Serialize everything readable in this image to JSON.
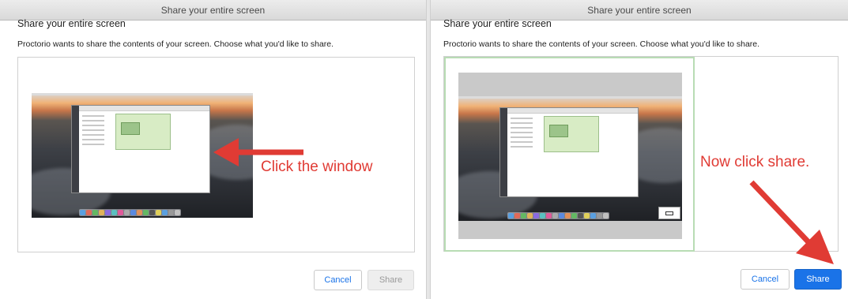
{
  "left": {
    "window_title": "Share your entire screen",
    "dialog_title": "Share your entire screen",
    "description": "Proctorio wants to share the contents of your screen. Choose what you'd like to share.",
    "annotation": "Click the window",
    "cancel_label": "Cancel",
    "share_label": "Share"
  },
  "right": {
    "window_title": "Share your entire screen",
    "dialog_title": "Share your entire screen",
    "description": "Proctorio wants to share the contents of your screen. Choose what you'd like to share.",
    "annotation": "Now click share.",
    "cancel_label": "Cancel",
    "share_label": "Share"
  },
  "colors": {
    "annotation_red": "#e03b34",
    "primary_blue": "#1a73e8",
    "selection_green": "#b8dcb4"
  }
}
